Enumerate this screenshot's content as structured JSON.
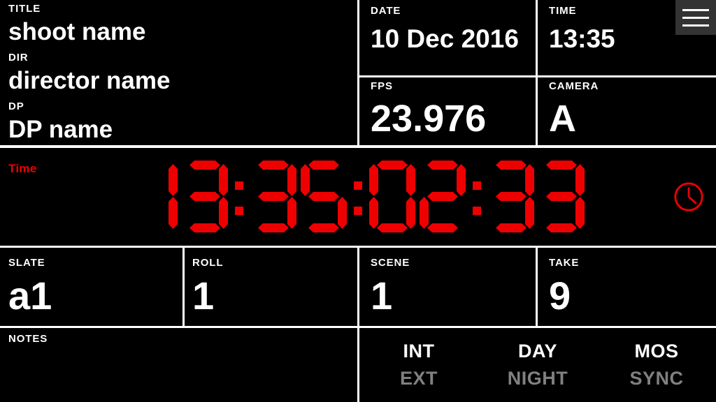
{
  "header": {
    "title": {
      "label": "TITLE",
      "value": "shoot name"
    },
    "director": {
      "label": "DIR",
      "value": "director name"
    },
    "dp": {
      "label": "DP",
      "value": "DP name"
    },
    "date": {
      "label": "DATE",
      "value": "10 Dec 2016"
    },
    "time": {
      "label": "TIME",
      "value": "13:35"
    },
    "fps": {
      "label": "FPS",
      "value": "23.976"
    },
    "camera": {
      "label": "CAMERA",
      "value": "A"
    },
    "menu_icon": "hamburger-menu-icon"
  },
  "timecode": {
    "label": "Time",
    "value": "13:35:02:33",
    "hours": "13",
    "minutes": "35",
    "seconds": "02",
    "frames": "33",
    "color": "#ee0000",
    "clock_icon": "clock-icon"
  },
  "slate": {
    "slate": {
      "label": "SLATE",
      "value": "a1"
    },
    "roll": {
      "label": "ROLL",
      "value": "1"
    },
    "scene": {
      "label": "SCENE",
      "value": "1"
    },
    "take": {
      "label": "TAKE",
      "value": "9"
    }
  },
  "bottom": {
    "notes": {
      "label": "NOTES",
      "value": "",
      "placeholder": ""
    },
    "toggles": [
      {
        "active_label": "INT",
        "inactive_label": "EXT",
        "selected": "INT"
      },
      {
        "active_label": "DAY",
        "inactive_label": "NIGHT",
        "selected": "DAY"
      },
      {
        "active_label": "MOS",
        "inactive_label": "SYNC",
        "selected": "MOS"
      }
    ]
  },
  "colors": {
    "background": "#000000",
    "foreground": "#ffffff",
    "accent_red": "#ee0000",
    "inactive_gray": "#808080",
    "menu_bg": "#333333"
  }
}
